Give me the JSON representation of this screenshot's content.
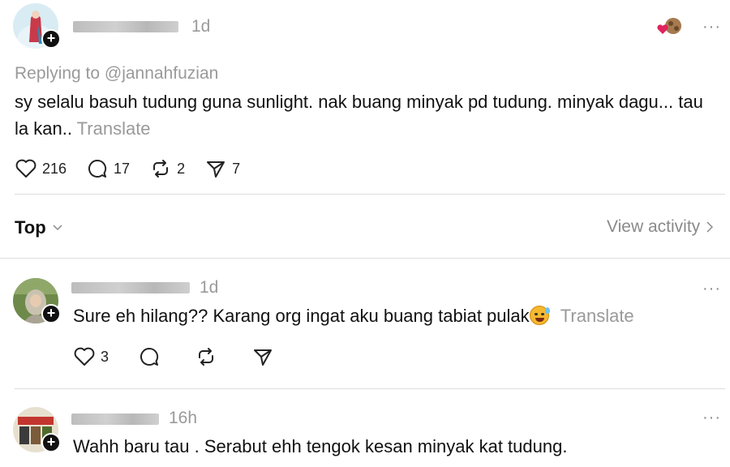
{
  "main_post": {
    "timestamp": "1d",
    "more_label": "···",
    "replying_to": "Replying to @jannahfuzian",
    "text": "sy selalu basuh tudung guna sunlight. nak buang minyak pd tudung. minyak dagu... tau la kan..",
    "translate": "Translate",
    "likes": "216",
    "comments": "17",
    "reposts": "2",
    "shares": "7"
  },
  "sort": {
    "label": "Top",
    "view_activity": "View activity"
  },
  "replies": [
    {
      "timestamp": "1d",
      "more_label": "···",
      "text": "Sure eh hilang?? Karang org ingat aku buang tabiat pulak",
      "translate": "Translate",
      "likes": "3"
    },
    {
      "timestamp": "16h",
      "more_label": "···",
      "text": "Wahh baru tau . Serabut ehh tengok kesan minyak kat tudung."
    }
  ],
  "colors": {
    "text": "#111111",
    "muted": "#9a9a9a",
    "divider": "#dcdcdc",
    "heart_red": "#e0245e"
  }
}
